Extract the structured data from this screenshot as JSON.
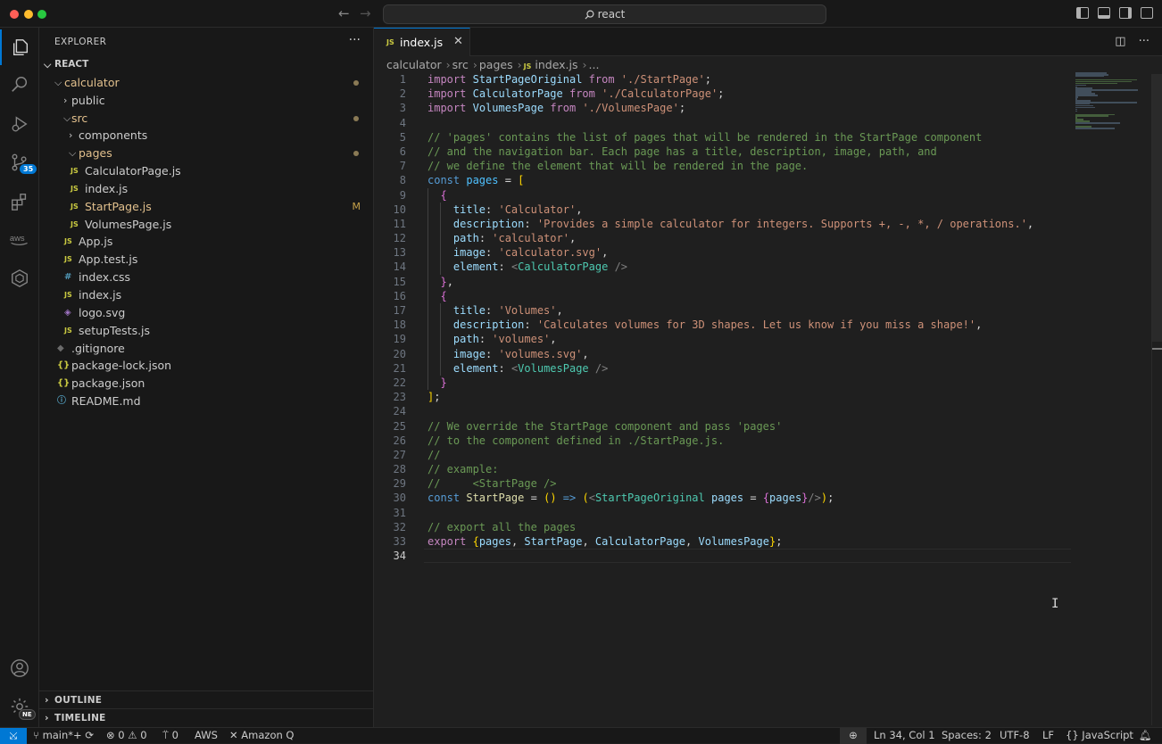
{
  "window": {
    "search_text": "react"
  },
  "sidebar": {
    "title": "EXPLORER",
    "more": "···",
    "root": "REACT",
    "tree": [
      {
        "label": "calculator",
        "depth": 0,
        "type": "folder-open",
        "modified_dot": true,
        "git": "modified"
      },
      {
        "label": "public",
        "depth": 1,
        "type": "folder"
      },
      {
        "label": "src",
        "depth": 1,
        "type": "folder-open",
        "modified_dot": true,
        "git": "modified"
      },
      {
        "label": "components",
        "depth": 2,
        "type": "folder"
      },
      {
        "label": "pages",
        "depth": 2,
        "type": "folder-open",
        "modified_dot": true,
        "git": "modified"
      },
      {
        "label": "CalculatorPage.js",
        "depth": 3,
        "type": "js"
      },
      {
        "label": "index.js",
        "depth": 3,
        "type": "js"
      },
      {
        "label": "StartPage.js",
        "depth": 3,
        "type": "js",
        "mark": "M",
        "git": "modified"
      },
      {
        "label": "VolumesPage.js",
        "depth": 3,
        "type": "js"
      },
      {
        "label": "App.js",
        "depth": 2,
        "type": "js"
      },
      {
        "label": "App.test.js",
        "depth": 2,
        "type": "js"
      },
      {
        "label": "index.css",
        "depth": 2,
        "type": "css"
      },
      {
        "label": "index.js",
        "depth": 2,
        "type": "js"
      },
      {
        "label": "logo.svg",
        "depth": 2,
        "type": "svg"
      },
      {
        "label": "setupTests.js",
        "depth": 2,
        "type": "js"
      },
      {
        "label": ".gitignore",
        "depth": 1,
        "type": "git"
      },
      {
        "label": "package-lock.json",
        "depth": 1,
        "type": "json"
      },
      {
        "label": "package.json",
        "depth": 1,
        "type": "json"
      },
      {
        "label": "README.md",
        "depth": 1,
        "type": "info"
      }
    ],
    "outline": "OUTLINE",
    "timeline": "TIMELINE"
  },
  "activity": {
    "scm_badge": "35",
    "account_badge": "NE"
  },
  "editor": {
    "tab_label": "index.js",
    "tab_icon": "JS",
    "breadcrumb": [
      "calculator",
      "src",
      "pages",
      "index.js",
      "..."
    ],
    "current_line": 34
  },
  "code_lines": [
    [
      [
        "k",
        "import"
      ],
      [
        "o",
        " "
      ],
      [
        "v",
        "StartPageOriginal"
      ],
      [
        "o",
        " "
      ],
      [
        "k",
        "from"
      ],
      [
        "o",
        " "
      ],
      [
        "s",
        "'./StartPage'"
      ],
      [
        "o",
        ";"
      ]
    ],
    [
      [
        "k",
        "import"
      ],
      [
        "o",
        " "
      ],
      [
        "v",
        "CalculatorPage"
      ],
      [
        "o",
        " "
      ],
      [
        "k",
        "from"
      ],
      [
        "o",
        " "
      ],
      [
        "s",
        "'./CalculatorPage'"
      ],
      [
        "o",
        ";"
      ]
    ],
    [
      [
        "k",
        "import"
      ],
      [
        "o",
        " "
      ],
      [
        "v",
        "VolumesPage"
      ],
      [
        "o",
        " "
      ],
      [
        "k",
        "from"
      ],
      [
        "o",
        " "
      ],
      [
        "s",
        "'./VolumesPage'"
      ],
      [
        "o",
        ";"
      ]
    ],
    [],
    [
      [
        "c",
        "// 'pages' contains the list of pages that will be rendered in the StartPage component"
      ]
    ],
    [
      [
        "c",
        "// and the navigation bar. Each page has a title, description, image, path, and"
      ]
    ],
    [
      [
        "c",
        "// we define the element that will be rendered in the page."
      ]
    ],
    [
      [
        "kw",
        "const"
      ],
      [
        "o",
        " "
      ],
      [
        "cn",
        "pages"
      ],
      [
        "o",
        " = "
      ],
      [
        "b1",
        "["
      ]
    ],
    [
      [
        "o",
        "  "
      ],
      [
        "b2",
        "{"
      ]
    ],
    [
      [
        "o",
        "    "
      ],
      [
        "v",
        "title"
      ],
      [
        "o",
        ": "
      ],
      [
        "s",
        "'Calculator'"
      ],
      [
        "o",
        ","
      ]
    ],
    [
      [
        "o",
        "    "
      ],
      [
        "v",
        "description"
      ],
      [
        "o",
        ": "
      ],
      [
        "s",
        "'Provides a simple calculator for integers. Supports +, -, *, / operations.'"
      ],
      [
        "o",
        ","
      ]
    ],
    [
      [
        "o",
        "    "
      ],
      [
        "v",
        "path"
      ],
      [
        "o",
        ": "
      ],
      [
        "s",
        "'calculator'"
      ],
      [
        "o",
        ","
      ]
    ],
    [
      [
        "o",
        "    "
      ],
      [
        "v",
        "image"
      ],
      [
        "o",
        ": "
      ],
      [
        "s",
        "'calculator.svg'"
      ],
      [
        "o",
        ","
      ]
    ],
    [
      [
        "o",
        "    "
      ],
      [
        "v",
        "element"
      ],
      [
        "o",
        ": "
      ],
      [
        "p",
        "<"
      ],
      [
        "t",
        "CalculatorPage"
      ],
      [
        "o",
        " "
      ],
      [
        "p",
        "/>"
      ]
    ],
    [
      [
        "o",
        "  "
      ],
      [
        "b2",
        "}"
      ],
      [
        "o",
        ","
      ]
    ],
    [
      [
        "o",
        "  "
      ],
      [
        "b2",
        "{"
      ]
    ],
    [
      [
        "o",
        "    "
      ],
      [
        "v",
        "title"
      ],
      [
        "o",
        ": "
      ],
      [
        "s",
        "'Volumes'"
      ],
      [
        "o",
        ","
      ]
    ],
    [
      [
        "o",
        "    "
      ],
      [
        "v",
        "description"
      ],
      [
        "o",
        ": "
      ],
      [
        "s",
        "'Calculates volumes for 3D shapes. Let us know if you miss a shape!'"
      ],
      [
        "o",
        ","
      ]
    ],
    [
      [
        "o",
        "    "
      ],
      [
        "v",
        "path"
      ],
      [
        "o",
        ": "
      ],
      [
        "s",
        "'volumes'"
      ],
      [
        "o",
        ","
      ]
    ],
    [
      [
        "o",
        "    "
      ],
      [
        "v",
        "image"
      ],
      [
        "o",
        ": "
      ],
      [
        "s",
        "'volumes.svg'"
      ],
      [
        "o",
        ","
      ]
    ],
    [
      [
        "o",
        "    "
      ],
      [
        "v",
        "element"
      ],
      [
        "o",
        ": "
      ],
      [
        "p",
        "<"
      ],
      [
        "t",
        "VolumesPage"
      ],
      [
        "o",
        " "
      ],
      [
        "p",
        "/>"
      ]
    ],
    [
      [
        "o",
        "  "
      ],
      [
        "b2",
        "}"
      ]
    ],
    [
      [
        "b1",
        "]"
      ],
      [
        "o",
        ";"
      ]
    ],
    [],
    [
      [
        "c",
        "// We override the StartPage component and pass 'pages'"
      ]
    ],
    [
      [
        "c",
        "// to the component defined in ./StartPage.js."
      ]
    ],
    [
      [
        "c",
        "//"
      ]
    ],
    [
      [
        "c",
        "// example:"
      ]
    ],
    [
      [
        "c",
        "//     <StartPage />"
      ]
    ],
    [
      [
        "kw",
        "const"
      ],
      [
        "o",
        " "
      ],
      [
        "f",
        "StartPage"
      ],
      [
        "o",
        " = "
      ],
      [
        "b1",
        "("
      ],
      [
        "b1",
        ")"
      ],
      [
        "o",
        " "
      ],
      [
        "kw",
        "=>"
      ],
      [
        "o",
        " "
      ],
      [
        "b1",
        "("
      ],
      [
        "p",
        "<"
      ],
      [
        "t",
        "StartPageOriginal"
      ],
      [
        "o",
        " "
      ],
      [
        "v",
        "pages"
      ],
      [
        "o",
        " = "
      ],
      [
        "b2",
        "{"
      ],
      [
        "v",
        "pages"
      ],
      [
        "b2",
        "}"
      ],
      [
        "p",
        "/>"
      ],
      [
        "b1",
        ")"
      ],
      [
        "o",
        ";"
      ]
    ],
    [],
    [
      [
        "c",
        "// export all the pages"
      ]
    ],
    [
      [
        "k",
        "export"
      ],
      [
        "o",
        " "
      ],
      [
        "b1",
        "{"
      ],
      [
        "v",
        "pages"
      ],
      [
        "o",
        ", "
      ],
      [
        "v",
        "StartPage"
      ],
      [
        "o",
        ", "
      ],
      [
        "v",
        "CalculatorPage"
      ],
      [
        "o",
        ", "
      ],
      [
        "v",
        "VolumesPage"
      ],
      [
        "b1",
        "}"
      ],
      [
        "o",
        ";"
      ]
    ],
    []
  ],
  "statusbar": {
    "branch": "main*+",
    "errors": "0",
    "warnings": "0",
    "ports": "0",
    "aws": "AWS",
    "amazonq": "Amazon Q",
    "position": "Ln 34, Col 1",
    "spaces": "Spaces: 2",
    "encoding": "UTF-8",
    "eol": "LF",
    "language": "JavaScript"
  }
}
